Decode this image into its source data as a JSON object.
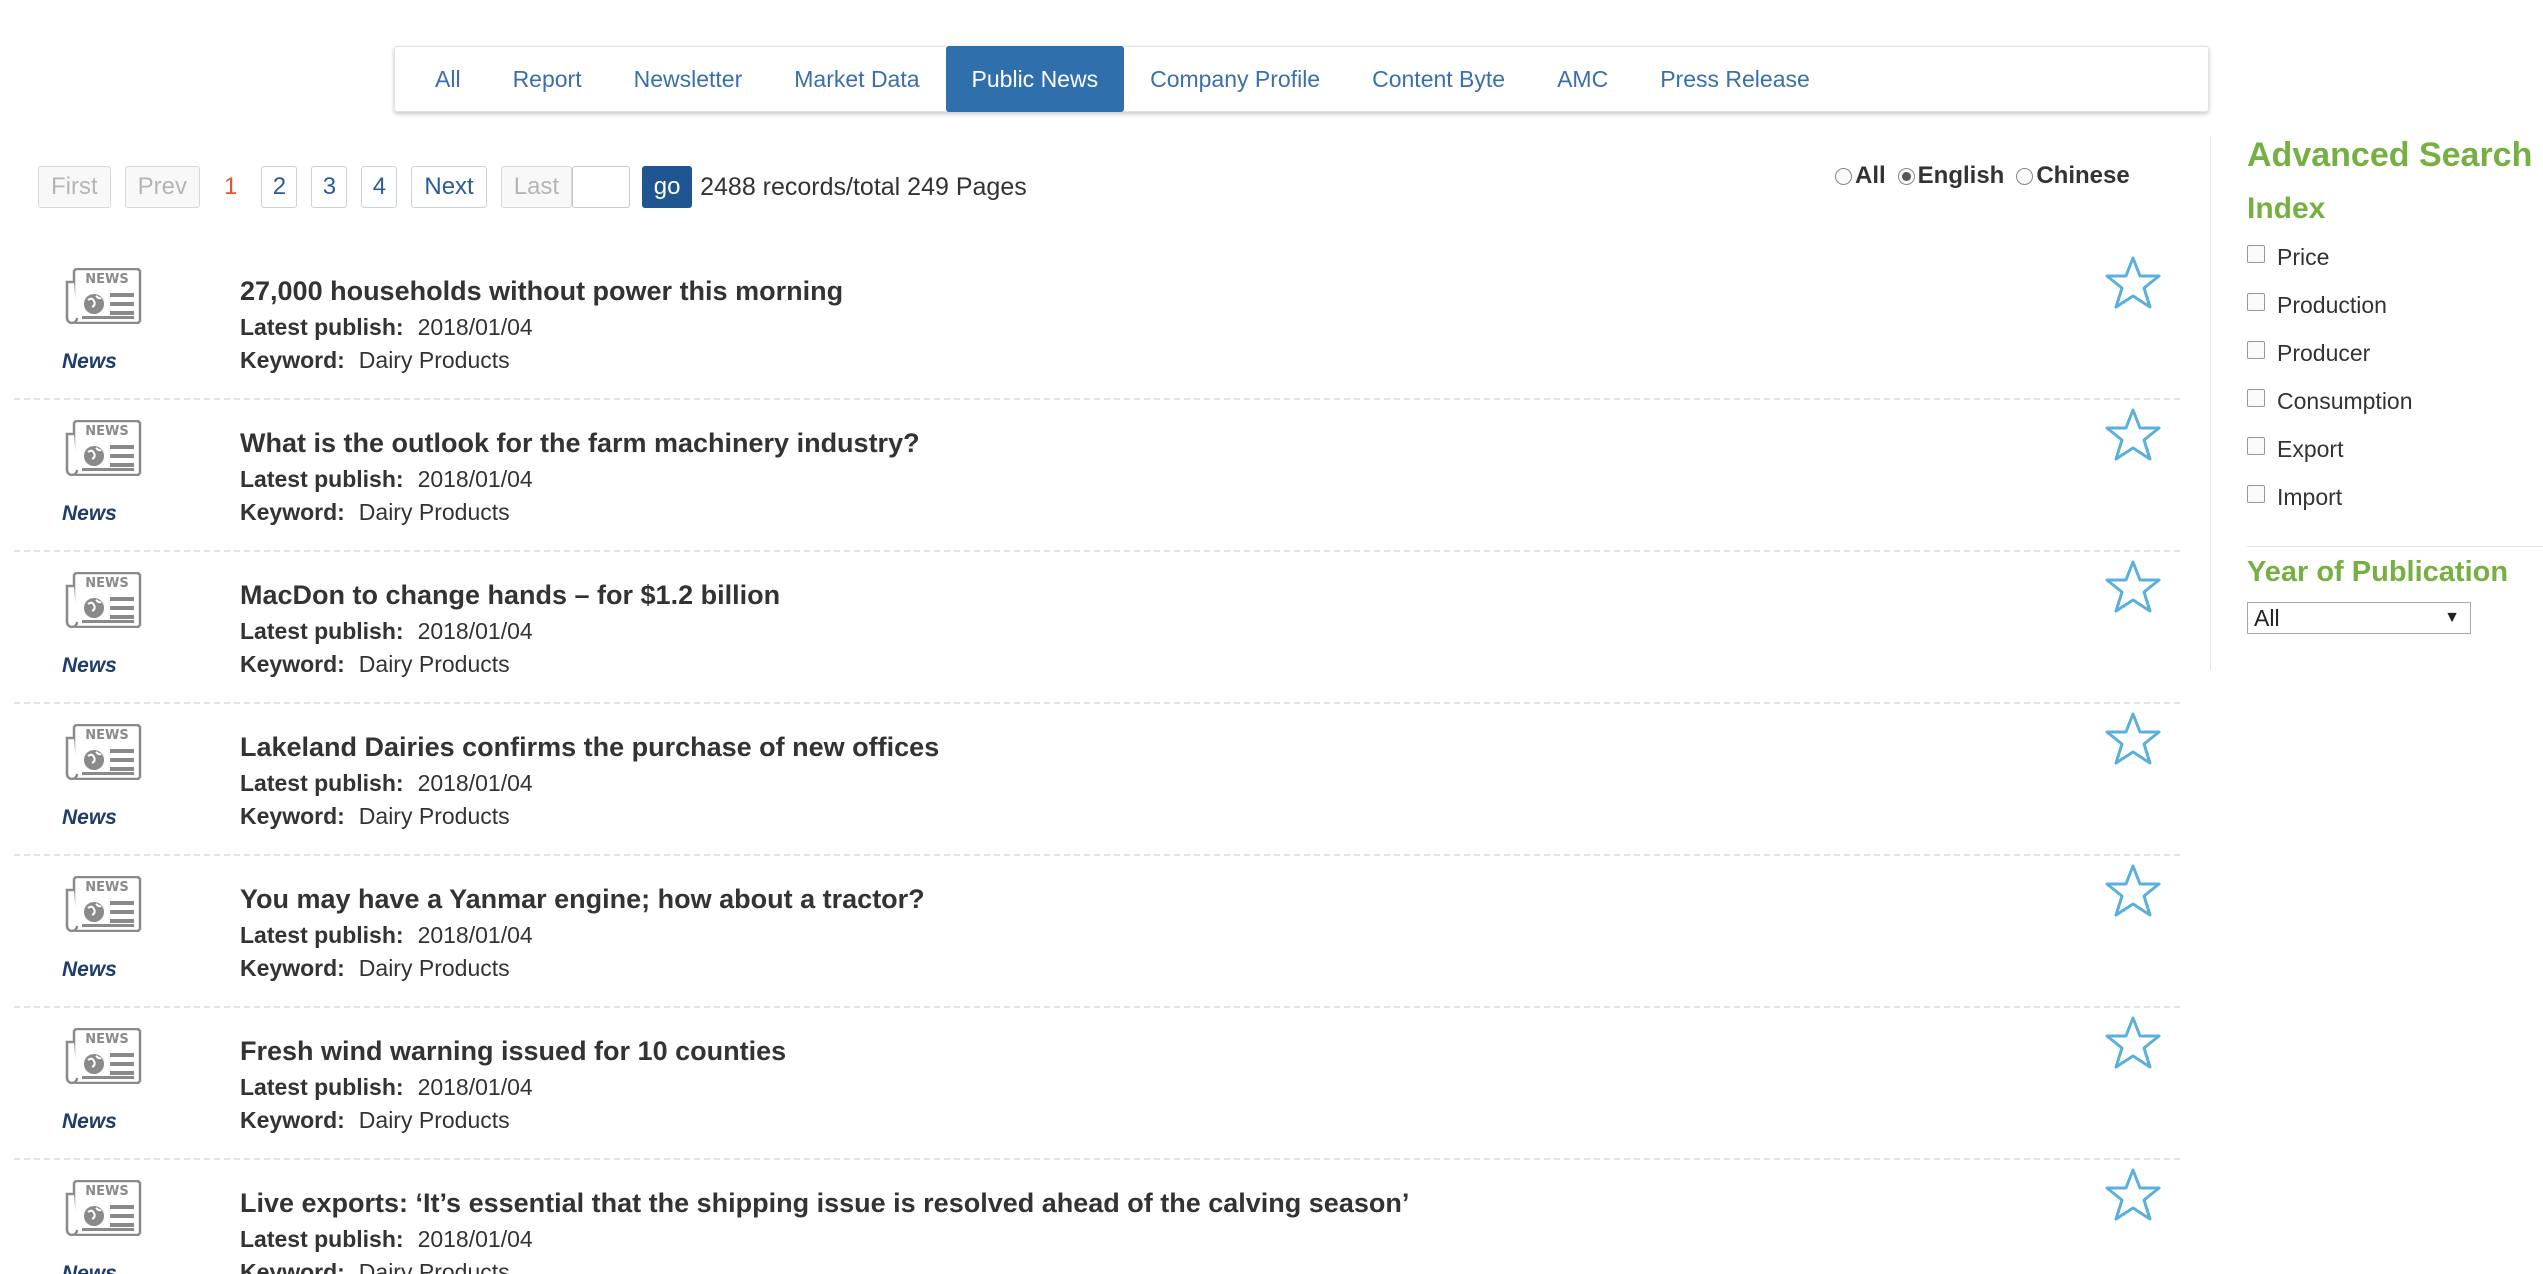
{
  "tabs": [
    {
      "label": "All",
      "active": false
    },
    {
      "label": "Report",
      "active": false
    },
    {
      "label": "Newsletter",
      "active": false
    },
    {
      "label": "Market Data",
      "active": false
    },
    {
      "label": "Public News",
      "active": true
    },
    {
      "label": "Company Profile",
      "active": false
    },
    {
      "label": "Content Byte",
      "active": false
    },
    {
      "label": "AMC",
      "active": false
    },
    {
      "label": "Press Release",
      "active": false
    }
  ],
  "pager": {
    "first": "First",
    "prev": "Prev",
    "current": "1",
    "pages": [
      "2",
      "3",
      "4"
    ],
    "next": "Next",
    "last": "Last",
    "input_value": "",
    "go": "go",
    "records": "2488 records/total 249 Pages"
  },
  "language": {
    "options": [
      {
        "label": "All",
        "checked": false
      },
      {
        "label": "English",
        "checked": true
      },
      {
        "label": "Chinese",
        "checked": false
      }
    ]
  },
  "list": {
    "publish_label": "Latest publish:",
    "keyword_label": "Keyword:",
    "type_label": "News",
    "items": [
      {
        "title": "27,000 households without power this morning",
        "date": "2018/01/04",
        "keyword": "Dairy Products"
      },
      {
        "title": "What is the outlook for the farm machinery industry?",
        "date": "2018/01/04",
        "keyword": "Dairy Products"
      },
      {
        "title": "MacDon to change hands – for $1.2 billion",
        "date": "2018/01/04",
        "keyword": "Dairy Products"
      },
      {
        "title": "Lakeland Dairies confirms the purchase of new offices",
        "date": "2018/01/04",
        "keyword": "Dairy Products"
      },
      {
        "title": "You may have a Yanmar engine; how about a tractor?",
        "date": "2018/01/04",
        "keyword": "Dairy Products"
      },
      {
        "title": "Fresh wind warning issued for 10 counties",
        "date": "2018/01/04",
        "keyword": "Dairy Products"
      },
      {
        "title": "Live exports: ‘It’s essential that the shipping issue is resolved ahead of the calving season’",
        "date": "2018/01/04",
        "keyword": "Dairy Products"
      }
    ]
  },
  "sidebar": {
    "title": "Advanced Search",
    "index_title": "Index",
    "index_options": [
      "Price",
      "Production",
      "Producer",
      "Consumption",
      "Export",
      "Import"
    ],
    "year_title": "Year of Publication",
    "year_value": "All"
  },
  "colors": {
    "accent_blue": "#2f6fac",
    "link_blue": "#3a6fae",
    "green": "#76b043",
    "current_page": "#e0572c",
    "star": "#5aafdc"
  },
  "icons": {
    "news": "news-icon",
    "star": "star-icon",
    "dropdown": "chevron-down-icon"
  }
}
